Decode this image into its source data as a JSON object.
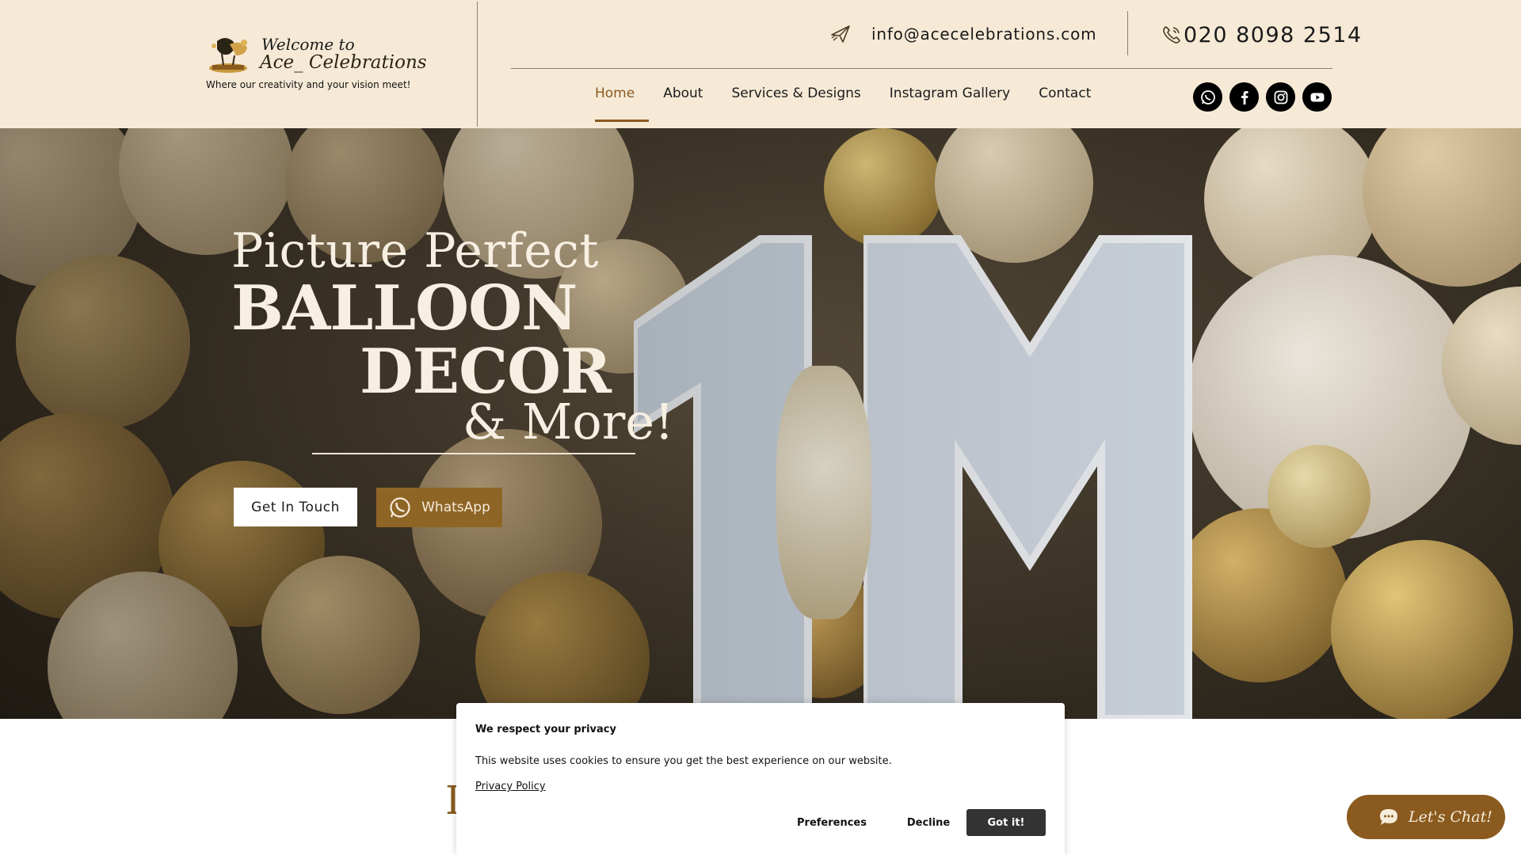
{
  "header": {
    "logo": {
      "line1": "Welcome to",
      "line2": "Ace_ Celebrations",
      "tagline": "Where our creativity and your vision meet!"
    },
    "email": "info@acecelebrations.com",
    "phone": "020 8098 2514",
    "nav": [
      {
        "label": "Home",
        "active": true
      },
      {
        "label": "About",
        "active": false
      },
      {
        "label": "Services & Designs",
        "active": false
      },
      {
        "label": "Instagram Gallery",
        "active": false
      },
      {
        "label": "Contact",
        "active": false
      }
    ],
    "socials": [
      "whatsapp-icon",
      "facebook-icon",
      "instagram-icon",
      "youtube-icon"
    ]
  },
  "hero": {
    "line1": "Picture Perfect",
    "line2": "BALLOON",
    "line3": "DECOR",
    "line4": "& More!",
    "cta_primary": "Get In Touch",
    "cta_whatsapp": "WhatsApp"
  },
  "cookie": {
    "title": "We respect your privacy",
    "text": "This website uses cookies to ensure you get the best experience on our website.",
    "link": "Privacy Policy",
    "preferences": "Preferences",
    "decline": "Decline",
    "accept": "Got it!"
  },
  "chat": {
    "label": "Let's Chat!"
  },
  "colors": {
    "header_bg": "#f6ead7",
    "accent": "#8a5a1f",
    "button_whatsapp": "#8f6526",
    "cookie_accept": "#333333"
  }
}
